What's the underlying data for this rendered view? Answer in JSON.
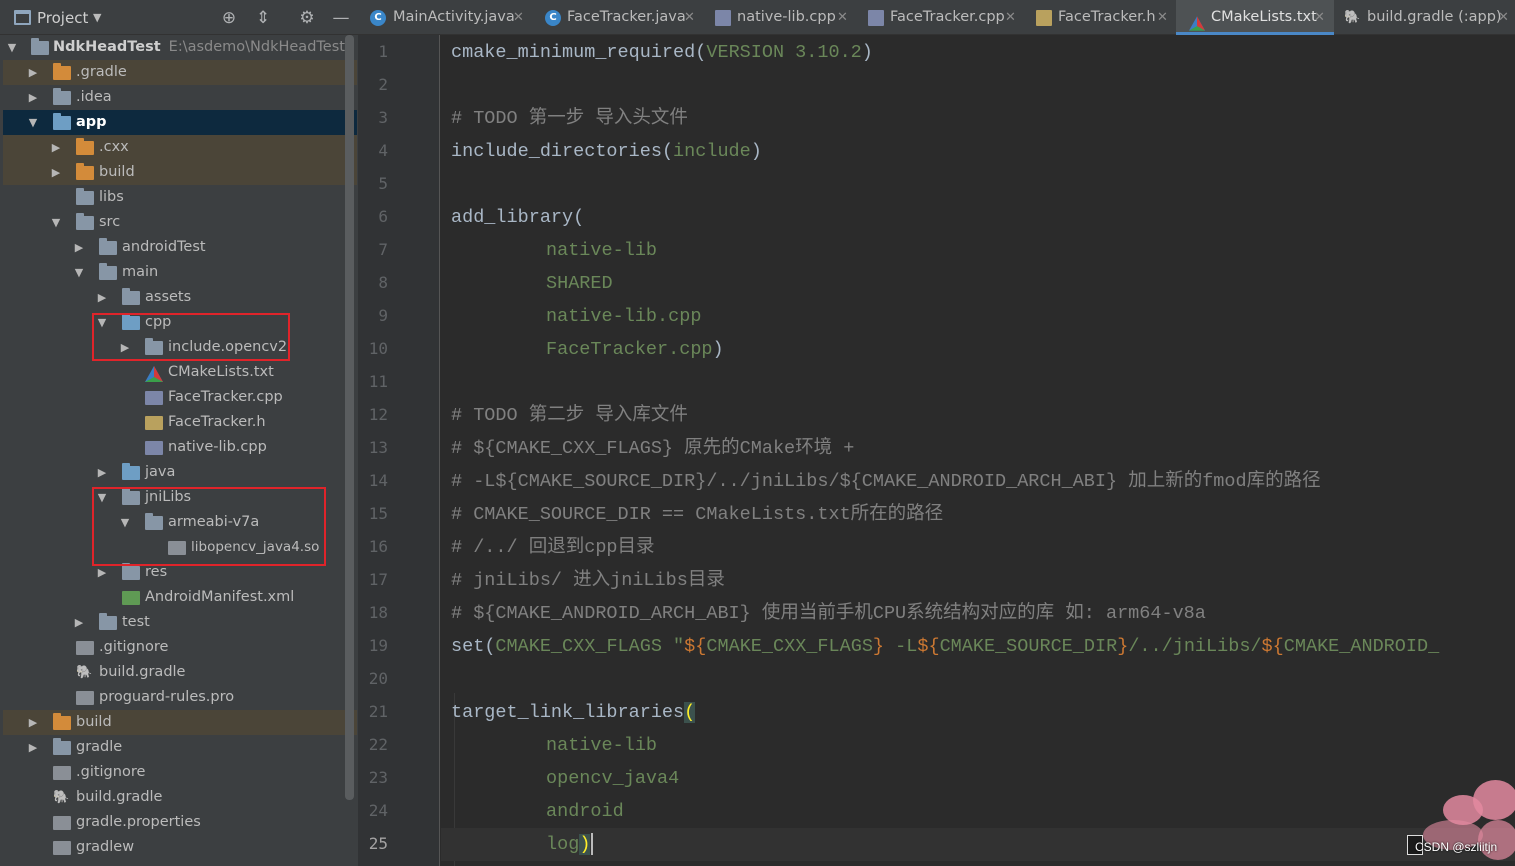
{
  "project_panel": {
    "title": "Project",
    "root": {
      "label": "NdkHeadTest",
      "path": "E:\\asdemo\\NdkHeadTest"
    },
    "tree": [
      {
        "label": ".gradle"
      },
      {
        "label": ".idea"
      },
      {
        "label": "app"
      },
      {
        "label": ".cxx"
      },
      {
        "label": "build"
      },
      {
        "label": "libs"
      },
      {
        "label": "src"
      },
      {
        "label": "androidTest"
      },
      {
        "label": "main"
      },
      {
        "label": "assets"
      },
      {
        "label": "cpp"
      },
      {
        "label": "include.opencv2"
      },
      {
        "label": "CMakeLists.txt"
      },
      {
        "label": "FaceTracker.cpp"
      },
      {
        "label": "FaceTracker.h"
      },
      {
        "label": "native-lib.cpp"
      },
      {
        "label": "java"
      },
      {
        "label": "jniLibs"
      },
      {
        "label": "armeabi-v7a"
      },
      {
        "label": "libopencv_java4.so"
      },
      {
        "label": "res"
      },
      {
        "label": "AndroidManifest.xml"
      },
      {
        "label": "test"
      },
      {
        "label": ".gitignore"
      },
      {
        "label": "build.gradle"
      },
      {
        "label": "proguard-rules.pro"
      },
      {
        "label": "build"
      },
      {
        "label": "gradle"
      },
      {
        "label": ".gitignore"
      },
      {
        "label": "build.gradle"
      },
      {
        "label": "gradle.properties"
      },
      {
        "label": "gradlew"
      }
    ]
  },
  "tabs": [
    {
      "label": "MainActivity.java",
      "icon": "java-class-icon"
    },
    {
      "label": "FaceTracker.java",
      "icon": "java-class-icon"
    },
    {
      "label": "native-lib.cpp",
      "icon": "cpp-file-icon"
    },
    {
      "label": "FaceTracker.cpp",
      "icon": "cpp-file-icon"
    },
    {
      "label": "FaceTracker.h",
      "icon": "header-file-icon"
    },
    {
      "label": "CMakeLists.txt",
      "icon": "cmake-file-icon",
      "active": true
    },
    {
      "label": "build.gradle (:app)",
      "icon": "gradle-file-icon"
    }
  ],
  "editor": {
    "current_line": 25,
    "line_numbers": [
      "1",
      "2",
      "3",
      "4",
      "5",
      "6",
      "7",
      "8",
      "9",
      "10",
      "11",
      "12",
      "13",
      "14",
      "15",
      "16",
      "17",
      "18",
      "19",
      "20",
      "21",
      "22",
      "23",
      "24",
      "25"
    ],
    "lines": {
      "l1_fn": "cmake_minimum_required",
      "l1_open": "(",
      "l1_arg": "VERSION 3.10.2",
      "l1_close": ")",
      "l3": "# TODO 第一步 导入头文件",
      "l4_fn": "include_directories",
      "l4_open": "(",
      "l4_arg": "include",
      "l4_close": ")",
      "l6_fn": "add_library",
      "l6_open": "(",
      "l7": "native-lib",
      "l8": "SHARED",
      "l9": "native-lib.cpp",
      "l10_arg": "FaceTracker.cpp",
      "l10_close": ")",
      "l12": "# TODO 第二步 导入库文件",
      "l13": "# ${CMAKE_CXX_FLAGS} 原先的CMake环境 +",
      "l14": "# -L${CMAKE_SOURCE_DIR}/../jniLibs/${CMAKE_ANDROID_ARCH_ABI} 加上新的fmod库的路径",
      "l15": "# CMAKE_SOURCE_DIR == CMakeLists.txt所在的路径",
      "l16": "# /../ 回退到cpp目录",
      "l17": "# jniLibs/ 进入jniLibs目录",
      "l18": "# ${CMAKE_ANDROID_ARCH_ABI} 使用当前手机CPU系统结构对应的库 如: arm64-v8a",
      "l19_fn": "set",
      "l19_open": "(",
      "l19_var": "CMAKE_CXX_FLAGS",
      "l19_q": " \"",
      "l19_d1": "${",
      "l19_v1": "CMAKE_CXX_FLAGS",
      "l19_e1": "}",
      "l19_mid": " -L",
      "l19_d2": "${",
      "l19_v2": "CMAKE_SOURCE_DIR",
      "l19_e2": "}",
      "l19_path": "/../jniLibs/",
      "l19_d3": "${",
      "l19_v3": "CMAKE_ANDROID_",
      "l21_fn": "target_link_libraries",
      "l21_open": "(",
      "l22": "native-lib",
      "l23": "opencv_java4",
      "l24": "android",
      "l25_arg": "log",
      "l25_close": ")"
    }
  },
  "watermark": {
    "text": "CSDN @szliitjn"
  }
}
